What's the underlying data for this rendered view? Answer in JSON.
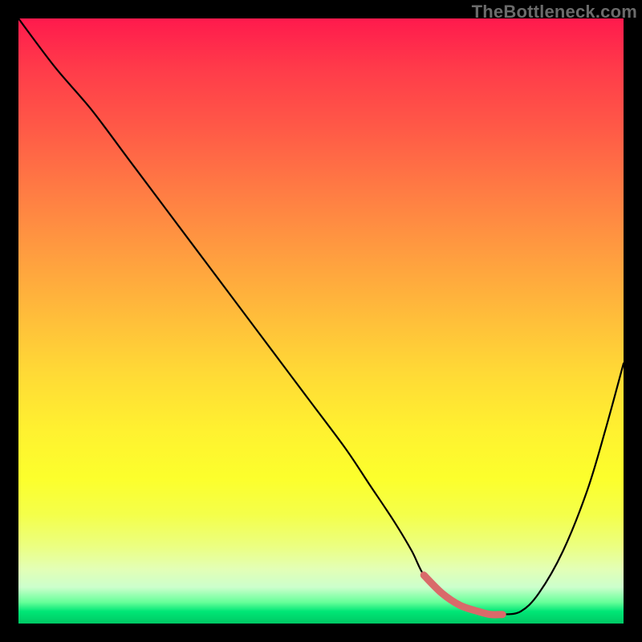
{
  "watermark": "TheBottleneck.com",
  "chart_data": {
    "type": "line",
    "title": "",
    "xlabel": "",
    "ylabel": "",
    "xlim": [
      0,
      100
    ],
    "ylim": [
      0,
      100
    ],
    "x": [
      0,
      6,
      12,
      18,
      24,
      30,
      36,
      42,
      48,
      54,
      58,
      62,
      65,
      67,
      70,
      73,
      76,
      78,
      80,
      83,
      86,
      90,
      94,
      97,
      100
    ],
    "values": [
      100,
      92,
      85,
      77,
      69,
      61,
      53,
      45,
      37,
      29,
      23,
      17,
      12,
      8,
      5,
      3,
      2,
      1.5,
      1.5,
      2,
      5,
      12,
      22,
      32,
      43
    ],
    "flat_region_x": [
      67,
      80
    ],
    "colors": {
      "line": "#000000",
      "flat_region": "#d96a6a",
      "gradient_top": "#ff1a4d",
      "gradient_bottom": "#00c864"
    }
  }
}
